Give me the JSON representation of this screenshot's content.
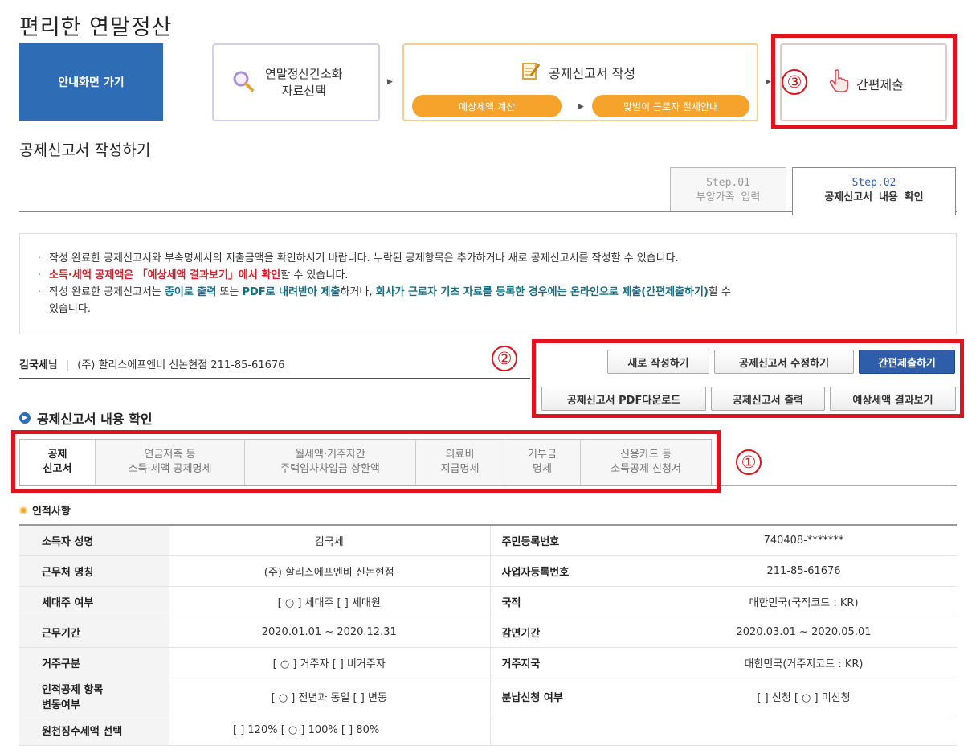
{
  "page_title": "편리한 연말정산",
  "guide_button": "안내화면 가기",
  "steps": {
    "step1_line1": "연말정산간소화",
    "step1_line2": "자료선택",
    "step2_title": "공제신고서 작성",
    "step2_pill1": "예상세액 계산",
    "step2_pill2": "맞벌이 근로자 절세안내",
    "step3_label": "간편제출"
  },
  "annotations": {
    "n1": "①",
    "n2": "②",
    "n3": "③"
  },
  "section_title": "공제신고서 작성하기",
  "step_tabs": [
    {
      "step": "Step.01",
      "label": "부양가족 입력"
    },
    {
      "step": "Step.02",
      "label": "공제신고서 내용 확인"
    }
  ],
  "notice": {
    "line1": "작성 완료한 공제신고서와 부속명세서의 지출금액을 확인하시기 바랍니다. 누락된 공제항목은 추가하거나 새로 공제신고서를 작성할 수 있습니다.",
    "line2_red": "소득·세액 공제액은 「예상세액 결과보기」에서 확인",
    "line2_rest": "할 수 있습니다.",
    "line3_a": "작성 완료한 공제신고서는 ",
    "line3_b": "종이로 출력",
    "line3_c": " 또는 ",
    "line3_d": "PDF로 내려받아 제출",
    "line3_e": "하거나, ",
    "line3_f": "회사가 근로자 기초 자료를 등록한 경우에는 온라인으로 제출(간편제출하기)",
    "line3_g": "할 수",
    "line3_h": "있습니다."
  },
  "person": {
    "name": "김국세",
    "suffix": "님",
    "company": "(주) 할리스에프엔비 신논현점 211-85-61676"
  },
  "buttons": {
    "new": "새로 작성하기",
    "edit": "공제신고서 수정하기",
    "submit": "간편제출하기",
    "pdf": "공제신고서 PDF다운로드",
    "print": "공제신고서 출력",
    "estimate": "예상세액 결과보기"
  },
  "sub_title": "공제신고서 내용 확인",
  "doc_tabs": [
    {
      "l1": "공제",
      "l2": "신고서"
    },
    {
      "l1": "연금저축 등",
      "l2": "소득·세액 공제명세"
    },
    {
      "l1": "월세액·거주자간",
      "l2": "주택임차차입금 상환액"
    },
    {
      "l1": "의료비",
      "l2": "지급명세"
    },
    {
      "l1": "기부금",
      "l2": "명세"
    },
    {
      "l1": "신용카드 등",
      "l2": "소득공제 신청서"
    }
  ],
  "info_title": "인적사항",
  "info": {
    "r1k1": "소득자 성명",
    "r1v1": "김국세",
    "r1k2": "주민등록번호",
    "r1v2": "740408-*******",
    "r2k1": "근무처 명칭",
    "r2v1": "(주) 할리스에프엔비 신논현점",
    "r2k2": "사업자등록번호",
    "r2v2": "211-85-61676",
    "r3k1": "세대주 여부",
    "r3v1": "[ ○ ] 세대주  [   ] 세대원",
    "r3k2": "국적",
    "r3v2": "대한민국(국적코드 : KR)",
    "r4k1": "근무기간",
    "r4v1": "2020.01.01 ~ 2020.12.31",
    "r4k2": "감면기간",
    "r4v2": "2020.03.01 ~ 2020.05.01",
    "r5k1": "거주구분",
    "r5v1": "[ ○ ] 거주자  [   ] 비거주자",
    "r5k2": "거주지국",
    "r5v2": "대한민국(거주지코드 : KR)",
    "r6k1a": "인적공제 항목",
    "r6k1b": "변동여부",
    "r6v1": "[ ○ ] 전년과 동일  [   ] 변동",
    "r6k2": "분납신청 여부",
    "r6v2": "[   ] 신청 [ ○ ] 미신청",
    "r7k1": "원천징수세액 선택",
    "r7v1": "[     ] 120%  [ ○ ] 100% [     ] 80%"
  }
}
